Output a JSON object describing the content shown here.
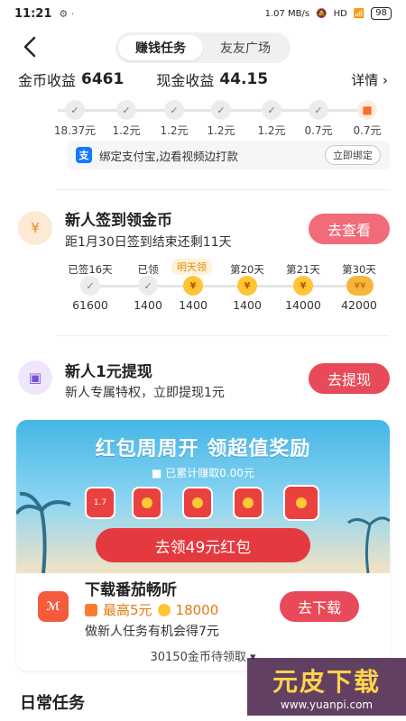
{
  "status": {
    "time": "11:21",
    "speed": "1.07 MB/s",
    "signal": "HD",
    "battery": "98"
  },
  "header": {
    "tabs": [
      {
        "label": "赚钱任务"
      },
      {
        "label": "友友广场"
      }
    ]
  },
  "earnings": {
    "coin_label": "金币收益",
    "coin_value": "6461",
    "cash_label": "现金收益",
    "cash_value": "44.15",
    "detail_label": "详情"
  },
  "withdraw_track": {
    "amounts": [
      "18.37元",
      "1.2元",
      "1.2元",
      "1.2元",
      "1.2元",
      "0.7元",
      "0.7元"
    ]
  },
  "alipay": {
    "text": "绑定支付宝,边看视频边打款",
    "button": "立即绑定"
  },
  "checkin": {
    "title": "新人签到领金币",
    "subtitle": "距1月30日签到结束还剩11天",
    "button": "去查看",
    "tomorrow_tag": "明天领",
    "days": [
      {
        "label": "已签16天",
        "value": "61600"
      },
      {
        "label": "已领",
        "value": "1400"
      },
      {
        "label": "",
        "value": "1400"
      },
      {
        "label": "第20天",
        "value": "1400"
      },
      {
        "label": "第21天",
        "value": "14000"
      },
      {
        "label": "第30天",
        "value": "42000"
      }
    ]
  },
  "newbie_withdraw": {
    "title": "新人1元提现",
    "subtitle": "新人专属特权，立即提现1元",
    "button": "去提现"
  },
  "promo": {
    "banner_title": "红包周周开 领超值奖励",
    "banner_sub": "已累计赚取0.00元",
    "first_envelope": "1.7",
    "cta": "去领49元红包",
    "app_name": "下载番茄畅听",
    "reward_cash": "最高5元",
    "reward_coins": "18000",
    "desc": "做新人任务有机会得7元",
    "button": "去下载",
    "pending": "30150金币待领取"
  },
  "daily_title": "日常任务",
  "watermark": {
    "title": "元皮下载",
    "url": "www.yuanpi.com"
  }
}
